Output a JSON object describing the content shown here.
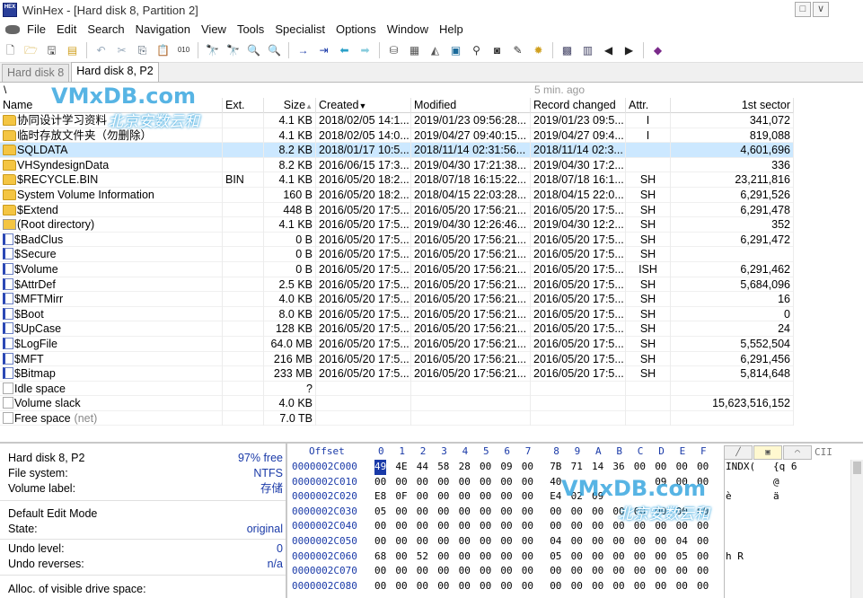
{
  "window": {
    "title": "WinHex - [Hard disk 8, Partition 2]",
    "icon_label": "HEX"
  },
  "menu": [
    "File",
    "Edit",
    "Search",
    "Navigation",
    "View",
    "Tools",
    "Specialist",
    "Options",
    "Window",
    "Help"
  ],
  "window_buttons": [
    "□",
    "∨",
    "✕"
  ],
  "toolbar_icons": [
    "new-icon",
    "open-icon",
    "save-icon",
    "properties-icon",
    "undo-icon",
    "cut-icon",
    "copy-icon",
    "paste-icon",
    "copy-block-icon",
    "find-text-icon",
    "find-hex-icon",
    "replace-text-icon",
    "replace-hex-icon",
    "goto-offset-icon",
    "goto-sector-icon",
    "back-icon",
    "forward-icon",
    "disk-icon",
    "ram-icon",
    "disk-tools-icon",
    "calculator-icon",
    "search-files-icon",
    "gallery-icon",
    "tools-icon",
    "settings-icon",
    "table-icon",
    "prev-icon",
    "next-icon",
    "help-icon"
  ],
  "tabs": [
    {
      "label": "Hard disk 8",
      "active": false
    },
    {
      "label": "Hard disk 8, P2",
      "active": true
    }
  ],
  "path": {
    "current": "\\",
    "refreshed": "5 min. ago"
  },
  "columns": {
    "name": "Name",
    "ext": "Ext.",
    "size": "Size",
    "created": "Created",
    "modified": "Modified",
    "record_changed": "Record changed",
    "attr": "Attr.",
    "first_sector": "1st sector"
  },
  "files": [
    {
      "icon": "folder",
      "name": "协同设计学习资料",
      "ext": "",
      "size": "4.1 KB",
      "created": "2018/02/05  14:1...",
      "modified": "2019/01/23  09:56:28...",
      "record": "2019/01/23  09:5...",
      "attr": "I",
      "sector": "341,072",
      "selected": false
    },
    {
      "icon": "folder",
      "name": "临时存放文件夹（勿删除）",
      "ext": "",
      "size": "4.1 KB",
      "created": "2018/02/05  14:0...",
      "modified": "2019/04/27  09:40:15...",
      "record": "2019/04/27  09:4...",
      "attr": "I",
      "sector": "819,088",
      "selected": false
    },
    {
      "icon": "folder",
      "name": "SQLDATA",
      "ext": "",
      "size": "8.2 KB",
      "created": "2018/01/17  10:5...",
      "modified": "2018/11/14  02:31:56...",
      "record": "2018/11/14  02:3...",
      "attr": "",
      "sector": "4,601,696",
      "selected": true
    },
    {
      "icon": "folder",
      "name": "VHSyndesignData",
      "ext": "",
      "size": "8.2 KB",
      "created": "2016/06/15  17:3...",
      "modified": "2019/04/30  17:21:38...",
      "record": "2019/04/30  17:2...",
      "attr": "",
      "sector": "336",
      "selected": false
    },
    {
      "icon": "folder",
      "name": "$RECYCLE.BIN",
      "ext": "BIN",
      "size": "4.1 KB",
      "created": "2016/05/20  18:2...",
      "modified": "2018/07/18  16:15:22...",
      "record": "2018/07/18  16:1...",
      "attr": "SH",
      "sector": "23,211,816",
      "selected": false
    },
    {
      "icon": "folder",
      "name": "System Volume Information",
      "ext": "",
      "size": "160 B",
      "created": "2016/05/20  18:2...",
      "modified": "2018/04/15  22:03:28...",
      "record": "2018/04/15  22:0...",
      "attr": "SH",
      "sector": "6,291,526",
      "selected": false
    },
    {
      "icon": "folder",
      "name": "$Extend",
      "ext": "",
      "size": "448 B",
      "created": "2016/05/20  17:5...",
      "modified": "2016/05/20  17:56:21...",
      "record": "2016/05/20  17:5...",
      "attr": "SH",
      "sector": "6,291,478",
      "selected": false
    },
    {
      "icon": "root",
      "name": "(Root directory)",
      "ext": "",
      "size": "4.1 KB",
      "created": "2016/05/20  17:5...",
      "modified": "2019/04/30  12:26:46...",
      "record": "2019/04/30  12:2...",
      "attr": "SH",
      "sector": "352",
      "selected": false
    },
    {
      "icon": "file",
      "name": "$BadClus",
      "ext": "",
      "size": "0 B",
      "created": "2016/05/20  17:5...",
      "modified": "2016/05/20  17:56:21...",
      "record": "2016/05/20  17:5...",
      "attr": "SH",
      "sector": "6,291,472",
      "selected": false
    },
    {
      "icon": "file",
      "name": "$Secure",
      "ext": "",
      "size": "0 B",
      "created": "2016/05/20  17:5...",
      "modified": "2016/05/20  17:56:21...",
      "record": "2016/05/20  17:5...",
      "attr": "SH",
      "sector": "",
      "selected": false
    },
    {
      "icon": "file",
      "name": "$Volume",
      "ext": "",
      "size": "0 B",
      "created": "2016/05/20  17:5...",
      "modified": "2016/05/20  17:56:21...",
      "record": "2016/05/20  17:5...",
      "attr": "ISH",
      "sector": "6,291,462",
      "selected": false
    },
    {
      "icon": "file",
      "name": "$AttrDef",
      "ext": "",
      "size": "2.5 KB",
      "created": "2016/05/20  17:5...",
      "modified": "2016/05/20  17:56:21...",
      "record": "2016/05/20  17:5...",
      "attr": "SH",
      "sector": "5,684,096",
      "selected": false
    },
    {
      "icon": "file",
      "name": "$MFTMirr",
      "ext": "",
      "size": "4.0 KB",
      "created": "2016/05/20  17:5...",
      "modified": "2016/05/20  17:56:21...",
      "record": "2016/05/20  17:5...",
      "attr": "SH",
      "sector": "16",
      "selected": false
    },
    {
      "icon": "file",
      "name": "$Boot",
      "ext": "",
      "size": "8.0 KB",
      "created": "2016/05/20  17:5...",
      "modified": "2016/05/20  17:56:21...",
      "record": "2016/05/20  17:5...",
      "attr": "SH",
      "sector": "0",
      "selected": false
    },
    {
      "icon": "file",
      "name": "$UpCase",
      "ext": "",
      "size": "128 KB",
      "created": "2016/05/20  17:5...",
      "modified": "2016/05/20  17:56:21...",
      "record": "2016/05/20  17:5...",
      "attr": "SH",
      "sector": "24",
      "selected": false
    },
    {
      "icon": "file",
      "name": "$LogFile",
      "ext": "",
      "size": "64.0 MB",
      "created": "2016/05/20  17:5...",
      "modified": "2016/05/20  17:56:21...",
      "record": "2016/05/20  17:5...",
      "attr": "SH",
      "sector": "5,552,504",
      "selected": false
    },
    {
      "icon": "file",
      "name": "$MFT",
      "ext": "",
      "size": "216 MB",
      "created": "2016/05/20  17:5...",
      "modified": "2016/05/20  17:56:21...",
      "record": "2016/05/20  17:5...",
      "attr": "SH",
      "sector": "6,291,456",
      "selected": false
    },
    {
      "icon": "file",
      "name": "$Bitmap",
      "ext": "",
      "size": "233 MB",
      "created": "2016/05/20  17:5...",
      "modified": "2016/05/20  17:56:21...",
      "record": "2016/05/20  17:5...",
      "attr": "SH",
      "sector": "5,814,648",
      "selected": false
    },
    {
      "icon": "blank",
      "name": "Idle space",
      "ext": "",
      "size": "?",
      "created": "",
      "modified": "",
      "record": "",
      "attr": "",
      "sector": "",
      "selected": false
    },
    {
      "icon": "blank",
      "name": "Volume slack",
      "ext": "",
      "size": "4.0 KB",
      "created": "",
      "modified": "",
      "record": "",
      "attr": "",
      "sector": "15,623,516,152",
      "selected": false
    },
    {
      "icon": "blank",
      "name": "Free space",
      "name_suffix": "(net)",
      "ext": "",
      "size": "7.0 TB",
      "created": "",
      "modified": "",
      "record": "",
      "attr": "",
      "sector": "",
      "selected": false
    }
  ],
  "info": {
    "disk_name": "Hard disk 8, P2",
    "free": "97% free",
    "fs_label": "File system:",
    "fs_value": "NTFS",
    "vol_label": "Volume label:",
    "vol_value": "存储",
    "mode_label": "Default Edit Mode",
    "state_label": "State:",
    "state_value": "original",
    "undo_label": "Undo level:",
    "undo_value": "0",
    "undo_rev_label": "Undo reverses:",
    "undo_rev_value": "n/a",
    "alloc_label": "Alloc. of visible drive space:"
  },
  "hex": {
    "offset_label": "Offset",
    "col_labels": [
      "0",
      "1",
      "2",
      "3",
      "4",
      "5",
      "6",
      "7",
      "8",
      "9",
      "A",
      "B",
      "C",
      "D",
      "E",
      "F"
    ],
    "text_head": "CII",
    "rows": [
      {
        "off": "0000002C000",
        "bytes": [
          "49",
          "4E",
          "44",
          "58",
          "28",
          "00",
          "09",
          "00",
          "7B",
          "71",
          "14",
          "36",
          "00",
          "00",
          "00",
          "00"
        ],
        "text": "INDX(   {q 6"
      },
      {
        "off": "0000002C010",
        "bytes": [
          "00",
          "00",
          "00",
          "00",
          "00",
          "00",
          "00",
          "00",
          "40",
          "",
          "",
          "",
          "",
          "09",
          "00",
          "00"
        ],
        "text": "        @"
      },
      {
        "off": "0000002C020",
        "bytes": [
          "E8",
          "0F",
          "00",
          "00",
          "00",
          "00",
          "00",
          "00",
          "E4",
          "02",
          "09",
          "",
          "",
          "",
          "",
          ""
        ],
        "text": "è       ä"
      },
      {
        "off": "0000002C030",
        "bytes": [
          "05",
          "00",
          "00",
          "00",
          "00",
          "00",
          "00",
          "00",
          "00",
          "00",
          "00",
          "00",
          "00",
          "00",
          "00",
          "00"
        ],
        "text": ""
      },
      {
        "off": "0000002C040",
        "bytes": [
          "00",
          "00",
          "00",
          "00",
          "00",
          "00",
          "00",
          "00",
          "00",
          "00",
          "00",
          "00",
          "00",
          "00",
          "00",
          "00"
        ],
        "text": ""
      },
      {
        "off": "0000002C050",
        "bytes": [
          "00",
          "00",
          "00",
          "00",
          "00",
          "00",
          "00",
          "00",
          "04",
          "00",
          "00",
          "00",
          "00",
          "00",
          "04",
          "00"
        ],
        "text": ""
      },
      {
        "off": "0000002C060",
        "bytes": [
          "68",
          "00",
          "52",
          "00",
          "00",
          "00",
          "00",
          "00",
          "05",
          "00",
          "00",
          "00",
          "00",
          "00",
          "05",
          "00"
        ],
        "text": "h R"
      },
      {
        "off": "0000002C070",
        "bytes": [
          "00",
          "00",
          "00",
          "00",
          "00",
          "00",
          "00",
          "00",
          "00",
          "00",
          "00",
          "00",
          "00",
          "00",
          "00",
          "00"
        ],
        "text": ""
      },
      {
        "off": "0000002C080",
        "bytes": [
          "00",
          "00",
          "00",
          "00",
          "00",
          "00",
          "00",
          "00",
          "00",
          "00",
          "00",
          "00",
          "00",
          "00",
          "00",
          "00"
        ],
        "text": ""
      }
    ]
  },
  "watermark": {
    "logo": "VMxDB.com",
    "sub": "北京安数云和"
  }
}
